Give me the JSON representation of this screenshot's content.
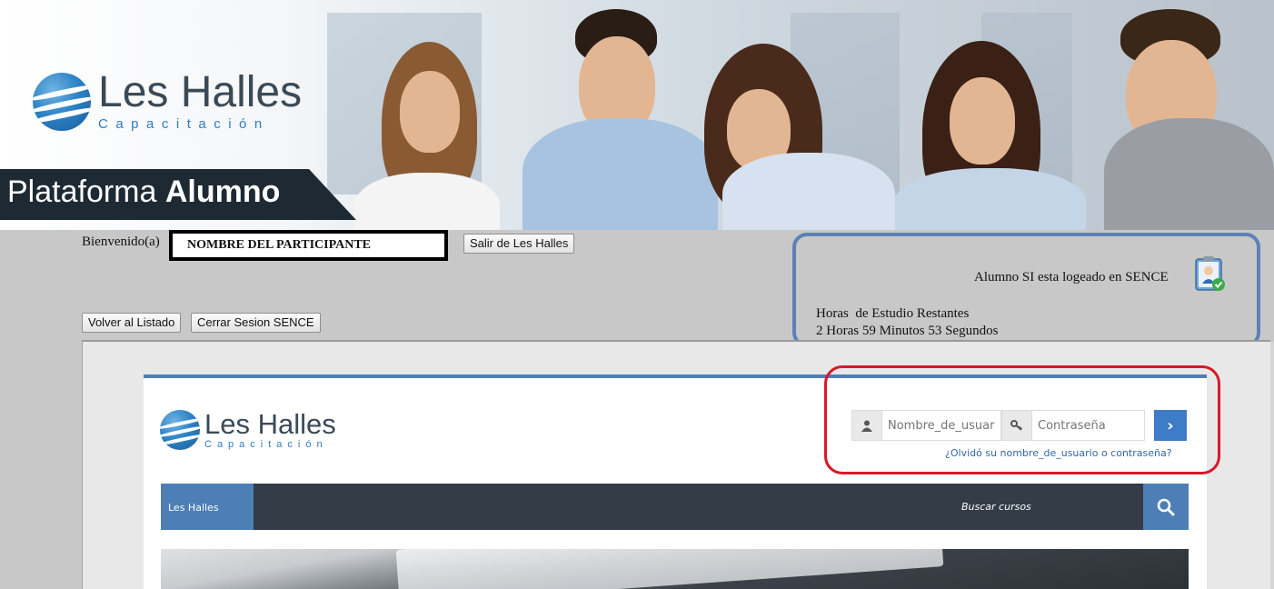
{
  "banner": {
    "logo_name": "Les Halles",
    "logo_sub": "Capacitación",
    "platform_prefix": "Plataforma",
    "platform_bold": "Alumno"
  },
  "header": {
    "welcome_label": "Bienvenido(a)",
    "participant_name": "NOMBRE DEL PARTICIPANTE",
    "logout_button": "Salir de Les Halles",
    "back_button": "Volver al Listado",
    "close_sence_button": "Cerrar Sesion SENCE"
  },
  "sence": {
    "status": "Alumno SI esta logeado en SENCE",
    "status_icon": "clipboard-user-check-icon",
    "hours_label": "Horas  de Estudio Restantes",
    "hours_value": "2 Horas 59 Minutos 53 Segundos",
    "box_color": "#5b82b6"
  },
  "site": {
    "logo_name": "Les Halles",
    "logo_sub": "Capacitación",
    "login": {
      "username_placeholder": "Nombre_de_usuario",
      "password_placeholder": "Contraseña",
      "user_icon": "user-icon",
      "key_icon": "key-icon",
      "submit_icon": "chevron-right-icon",
      "forgot_link": "¿Olvidó su nombre_de_usuario o contraseña?",
      "highlight_color": "#d7192a"
    },
    "nav": {
      "home": "Les Halles",
      "search_placeholder": "Buscar cursos",
      "search_icon": "search-icon"
    },
    "accent": "#4d7fb6",
    "nav_bg": "#333c47"
  }
}
